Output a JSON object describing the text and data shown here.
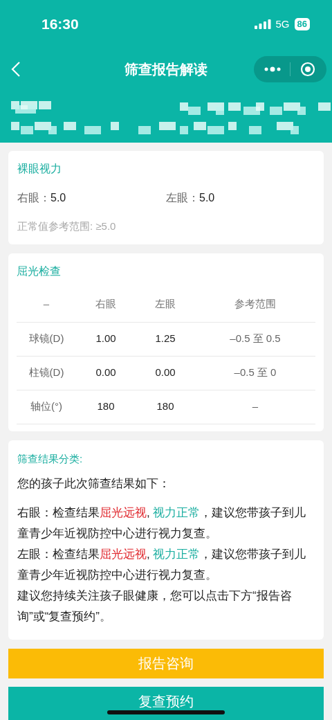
{
  "status_bar": {
    "time": "16:30",
    "network": "5G",
    "battery": "86"
  },
  "nav": {
    "title": "筛查报告解读"
  },
  "naked_vision": {
    "title": "裸眼视力",
    "eyes": [
      {
        "label": "右眼：",
        "value": "5.0"
      },
      {
        "label": "左眼：",
        "value": "5.0"
      }
    ],
    "reference": "正常值参考范围: ≥5.0"
  },
  "refraction": {
    "title": "屈光检查",
    "columns": [
      "–",
      "右眼",
      "左眼",
      "参考范围"
    ],
    "rows": [
      [
        "球镜(D)",
        "1.00",
        "1.25",
        "–0.5 至 0.5"
      ],
      [
        "柱镜(D)",
        "0.00",
        "0.00",
        "–0.5 至 0"
      ],
      [
        "轴位(°)",
        "180",
        "180",
        "–"
      ]
    ]
  },
  "result": {
    "title": "筛查结果分类:",
    "intro": "您的孩子此次筛查结果如下：",
    "paragraphs": [
      [
        {
          "text": "右眼：检查结果",
          "kind": "plain"
        },
        {
          "text": "屈光远视",
          "kind": "abnormal"
        },
        {
          "text": ", ",
          "kind": "plain"
        },
        {
          "text": "视力正常",
          "kind": "normal"
        },
        {
          "text": "，建议您带孩子到儿童青少年近视防控中心进行视力复查。",
          "kind": "plain"
        }
      ],
      [
        {
          "text": "左眼：检查结果",
          "kind": "plain"
        },
        {
          "text": "屈光远视",
          "kind": "abnormal"
        },
        {
          "text": ", ",
          "kind": "plain"
        },
        {
          "text": "视力正常",
          "kind": "normal"
        },
        {
          "text": "，建议您带孩子到儿童青少年近视防控中心进行视力复查。",
          "kind": "plain"
        }
      ],
      [
        {
          "text": "建议您持续关注孩子眼健康，您可以点击下方“报告咨询”或“复查预约”。",
          "kind": "plain"
        }
      ]
    ]
  },
  "buttons": [
    {
      "label": "报告咨询",
      "kind": "primary"
    },
    {
      "label": "复查预约",
      "kind": "secondary"
    }
  ]
}
